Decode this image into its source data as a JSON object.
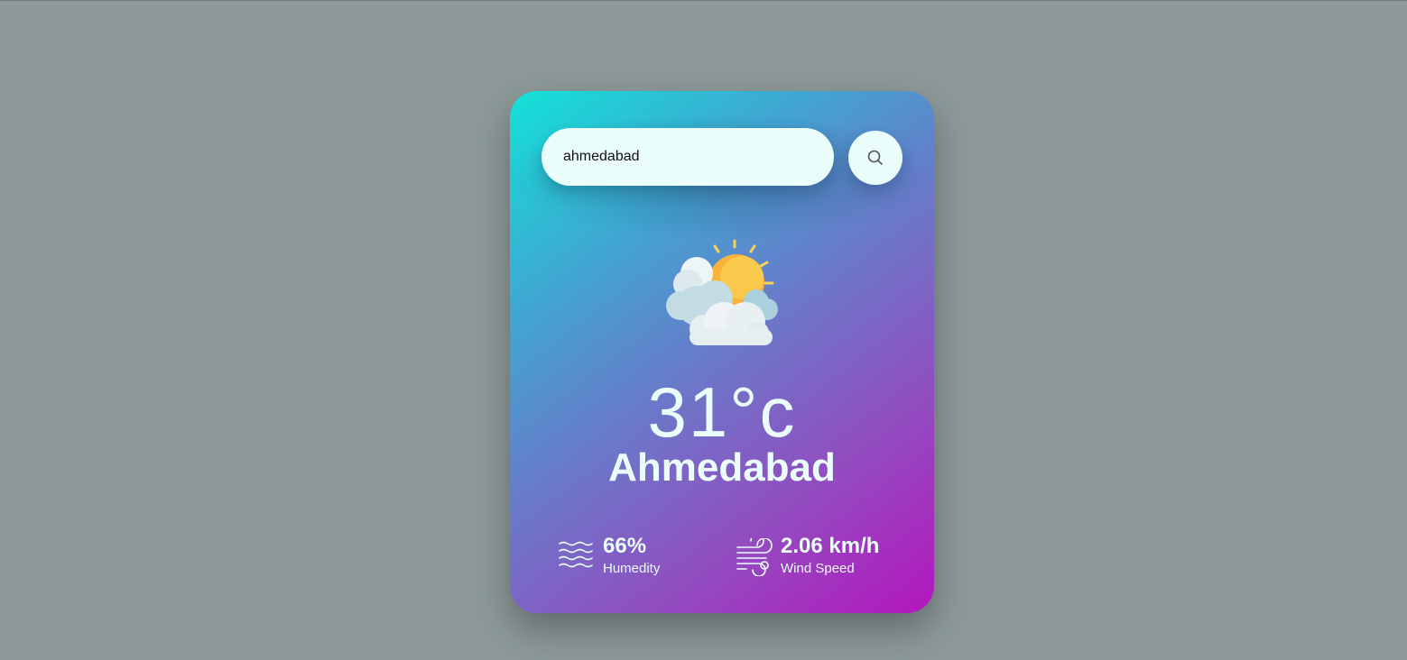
{
  "search": {
    "value": "ahmedabad",
    "placeholder": "",
    "button_icon": "search-icon"
  },
  "weather": {
    "condition_icon": "partly-cloudy-sun-icon",
    "temperature": "31°c",
    "city": "Ahmedabad"
  },
  "stats": {
    "humidity": {
      "icon": "humidity-waves-icon",
      "value": "66%",
      "label": "Humedity"
    },
    "wind": {
      "icon": "wind-icon",
      "value": "2.06 km/h",
      "label": "Wind Speed"
    }
  },
  "colors": {
    "page_background": "#8d9a99",
    "card_gradient_start": "#12e2d8",
    "card_gradient_end": "#b416bd",
    "text_light": "#eafdfb"
  }
}
